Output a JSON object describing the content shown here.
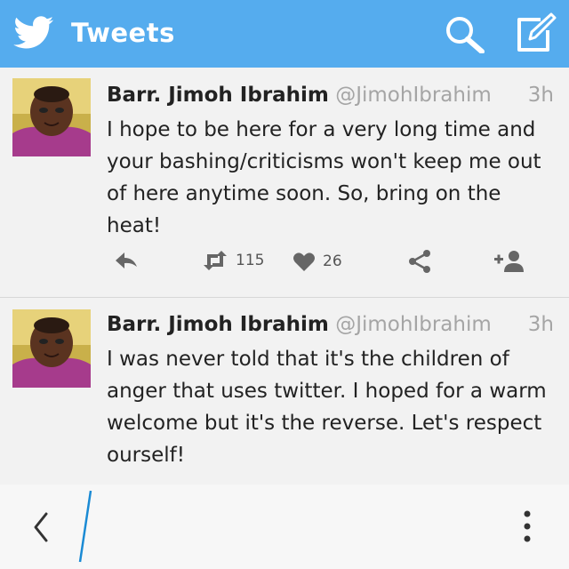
{
  "header": {
    "title": "Tweets",
    "logo_icon": "twitter-bird-icon",
    "search_icon": "search-icon",
    "compose_icon": "compose-icon",
    "accent": "#55acee"
  },
  "tweets": [
    {
      "name": "Barr. Jimoh Ibrahim",
      "handle": "@JimohIbrahim",
      "time": "3h",
      "text": "I hope to be here for a very long time and your bashing/criticisms won't keep me out of here anytime soon. So, bring on the heat!",
      "retweets": "115",
      "likes": "26"
    },
    {
      "name": "Barr. Jimoh Ibrahim",
      "handle": "@JimohIbrahim",
      "time": "3h",
      "text": "I was never told that it's the children of anger that uses twitter. I hoped for a warm welcome but it's the reverse. Let's respect ourself!"
    }
  ],
  "bottom_bar": {
    "back_icon": "back-chevron-icon",
    "more_icon": "more-vertical-icon"
  }
}
